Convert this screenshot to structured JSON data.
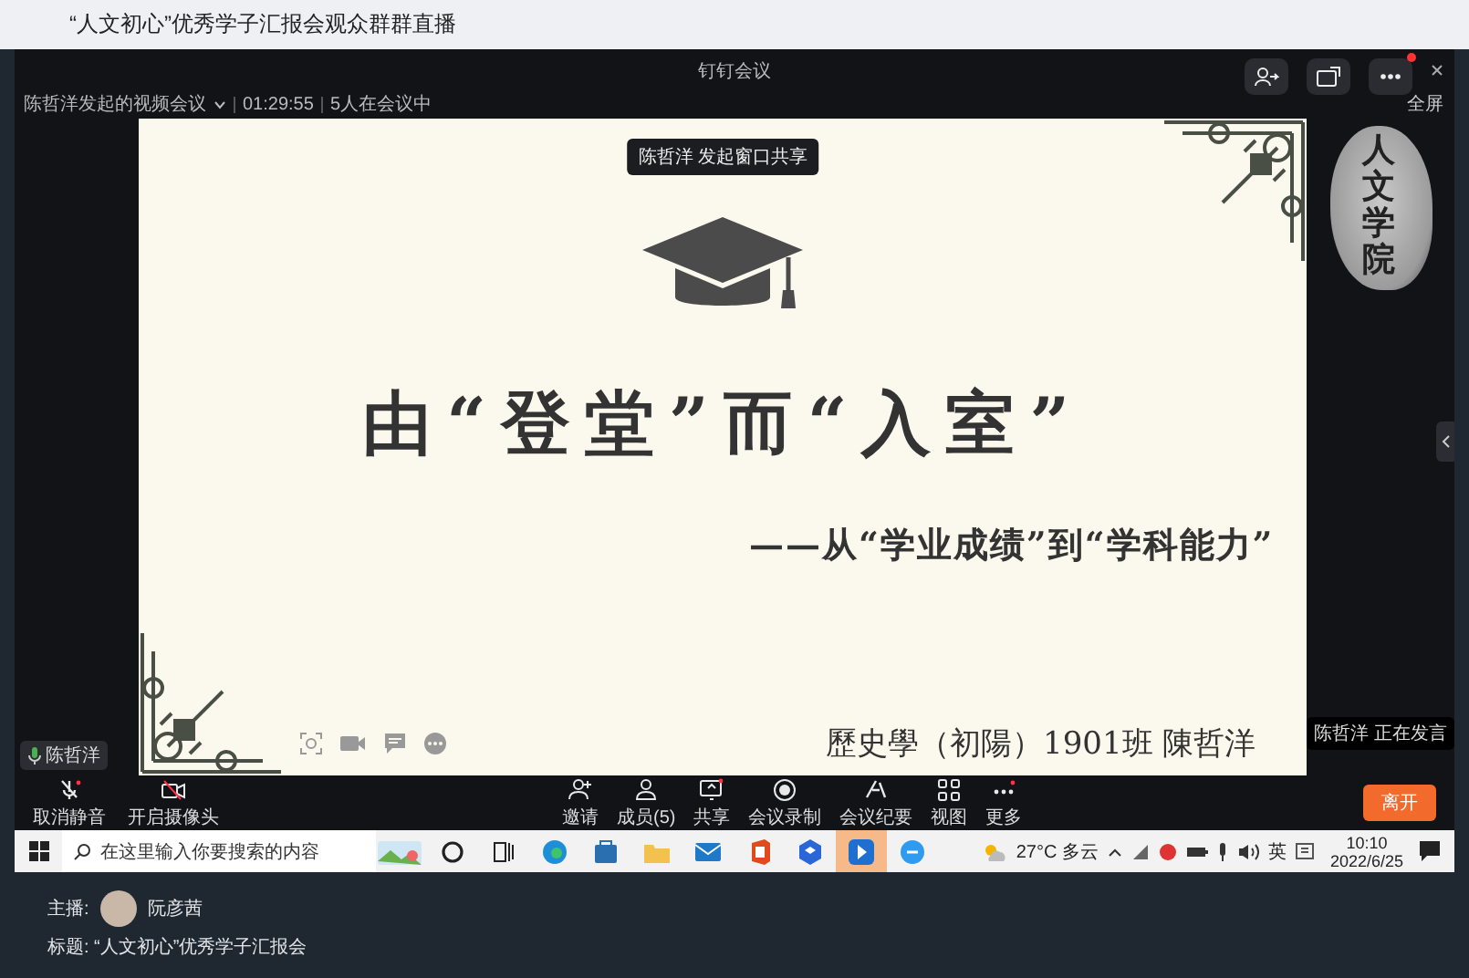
{
  "page_title": "“人文初心”优秀学子汇报会观众群群直播",
  "meeting": {
    "title": "钉钉会议",
    "fullscreen_label": "全屏",
    "meeting_name": "陈哲洋发起的视频会议",
    "duration": "01:29:55",
    "participants": "5人在会议中",
    "share_banner": "陈哲洋 发起窗口共享",
    "mic_tag": "陈哲洋",
    "speaking_tag": "陈哲洋 正在发言",
    "logo": "人文学院"
  },
  "slide": {
    "title": "由“登堂”而“入室”",
    "subtitle": "——从“学业成绩”到“学科能力”",
    "author": "歷史學（初陽）1901班 陳哲洋"
  },
  "toolbar_left": [
    {
      "kind": "mic",
      "label": "取消静音"
    },
    {
      "kind": "camera",
      "label": "开启摄像头"
    }
  ],
  "toolbar_center": [
    {
      "kind": "invite",
      "label": "邀请"
    },
    {
      "kind": "members",
      "label": "成员(5)"
    },
    {
      "kind": "share",
      "label": "共享"
    },
    {
      "kind": "record",
      "label": "会议录制"
    },
    {
      "kind": "notes",
      "label": "会议纪要"
    },
    {
      "kind": "view",
      "label": "视图"
    },
    {
      "kind": "more",
      "label": "更多"
    }
  ],
  "leave_button": "离开",
  "taskbar": {
    "search_placeholder": "在这里输入你要搜索的内容",
    "apps": [
      {
        "kind": "cortana",
        "selected": false
      },
      {
        "kind": "taskview",
        "selected": false
      },
      {
        "kind": "browser",
        "selected": false
      },
      {
        "kind": "store",
        "selected": false
      },
      {
        "kind": "folder",
        "selected": false
      },
      {
        "kind": "mail",
        "selected": false
      },
      {
        "kind": "office",
        "selected": false
      },
      {
        "kind": "cube",
        "selected": false
      },
      {
        "kind": "meeting",
        "selected": true
      },
      {
        "kind": "chat",
        "selected": false
      }
    ],
    "weather": "27°C 多云",
    "ime": "英",
    "time": "10:10",
    "date": "2022/6/25"
  },
  "stream": {
    "host_label": "主播:",
    "host_name": "阮彦茜",
    "title": "标题: “人文初心”优秀学子汇报会"
  }
}
